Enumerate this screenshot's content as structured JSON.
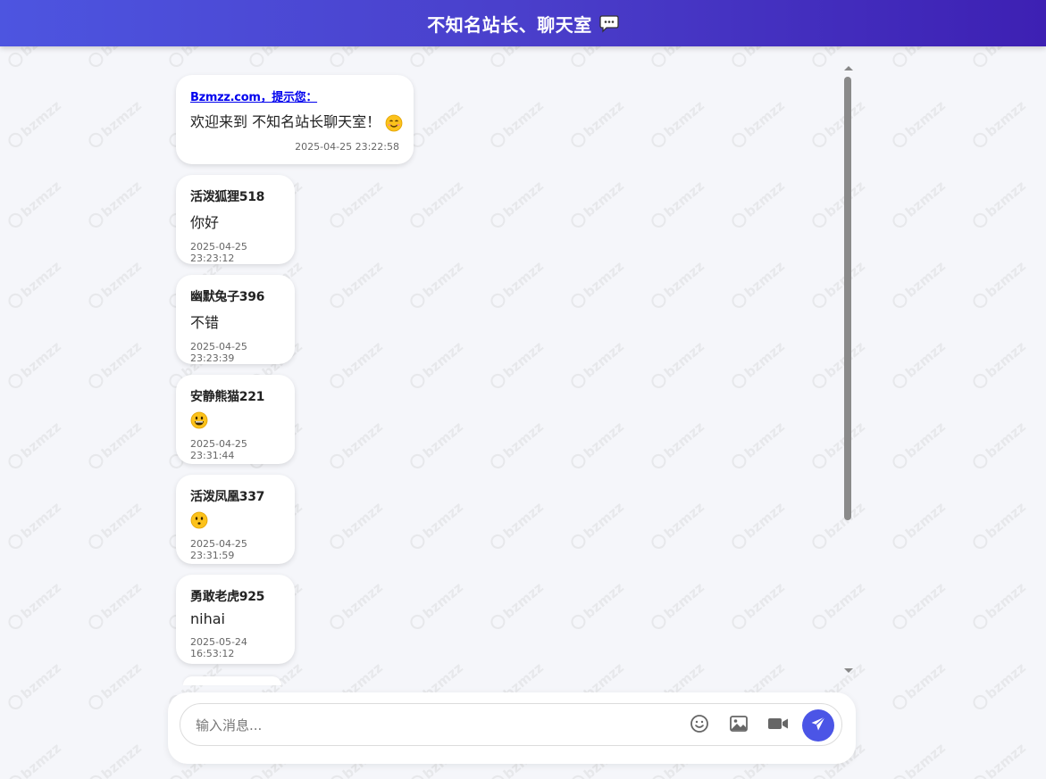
{
  "header": {
    "title": "不知名站长、聊天室",
    "icon": "speech-bubble-icon"
  },
  "watermark": {
    "text": "bzmzz"
  },
  "messages": [
    {
      "sender": "Bzmzz.com，提示您：",
      "text": "欢迎来到 不知名站长聊天室！",
      "emoji": "smiling-face-icon",
      "time": "2025-04-25 23:22:58"
    },
    {
      "sender": "活泼狐狸518",
      "text": "你好",
      "time": "2025-04-25 23:23:12"
    },
    {
      "sender": "幽默兔子396",
      "text": "不错",
      "time": "2025-04-25 23:23:39"
    },
    {
      "sender": "安静熊猫221",
      "text": "",
      "emoji": "grinning-face-icon",
      "time": "2025-04-25 23:31:44"
    },
    {
      "sender": "活泼凤凰337",
      "text": "",
      "emoji": "hushed-face-icon",
      "time": "2025-04-25 23:31:59"
    },
    {
      "sender": "勇敢老虎925",
      "text": "nihai",
      "time": "2025-05-24 16:53:12"
    }
  ],
  "composer": {
    "placeholder": "输入消息...",
    "emoji_button_icon": "smiley-icon",
    "image_button_icon": "image-icon",
    "video_button_icon": "video-camera-icon",
    "send_button_icon": "paper-plane-icon"
  },
  "colors": {
    "header_gradient_start": "#4d55e0",
    "header_gradient_end": "#3d20b3",
    "send_button": "#4b55e6",
    "link": "#0000ee"
  }
}
